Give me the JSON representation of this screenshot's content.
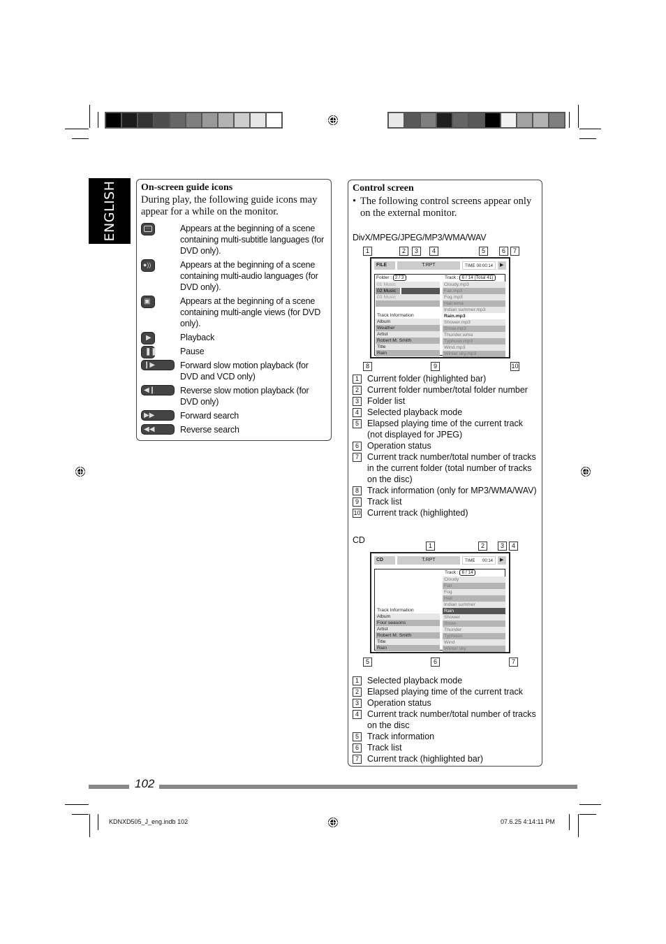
{
  "language_tab": "ENGLISH",
  "guide_icons": {
    "title": "On-screen guide icons",
    "intro": "During play, the following guide icons may appear for a while on the monitor.",
    "items": [
      {
        "icon": "subtitle-icon",
        "text": "Appears at the beginning of a scene containing multi-subtitle languages (for DVD only)."
      },
      {
        "icon": "audio-icon",
        "text": "Appears at the beginning of a scene containing multi-audio languages (for DVD only)."
      },
      {
        "icon": "angle-icon",
        "text": "Appears at the beginning of a scene containing multi-angle views (for DVD only)."
      },
      {
        "icon": "play-icon",
        "text": "Playback"
      },
      {
        "icon": "pause-icon",
        "text": "Pause"
      },
      {
        "icon": "forward-slow-icon",
        "text": "Forward slow motion playback (for DVD and VCD only)"
      },
      {
        "icon": "reverse-slow-icon",
        "text": "Reverse slow motion playback (for DVD only)"
      },
      {
        "icon": "forward-search-icon",
        "text": "Forward search"
      },
      {
        "icon": "reverse-search-icon",
        "text": "Reverse search"
      }
    ]
  },
  "control_screen": {
    "title": "Control screen",
    "bullet": "The following control screens appear only on the external monitor.",
    "divx": {
      "heading": "DivX/MPEG/JPEG/MP3/WMA/WAV",
      "screen": {
        "mode_label": "FILE",
        "repeat": "T.RPT",
        "time_label": "TIME",
        "time_value": "00:00:14",
        "status_glyph": "▶",
        "folder_label": "Folder :",
        "folder_value": "2 / 3",
        "track_label": "Track :",
        "track_value": "6 / 14 (Total 41)",
        "folders": [
          "01 Music",
          "02 Music",
          "03 Music",
          ""
        ],
        "current_folder_index": 1,
        "info_heading": "Track Information",
        "info_rows": [
          "Album",
          "Weather",
          "Artist",
          "Robert M. Smith",
          "Title",
          "Rain"
        ],
        "tracks": [
          "Cloudy.mp3",
          "Fair.mp3",
          "Fog.mp3",
          "Hail.wma",
          "Indian summer.mp3",
          "Rain.mp3",
          "Shower.mp3",
          "Snow.mp3",
          "Thunder.wma",
          "Typhoon.mp3",
          "Wind.mp3",
          "Winter sky.mp3"
        ],
        "current_track_index": 5
      },
      "callout_numbers": [
        "1",
        "2",
        "3",
        "4",
        "5",
        "6",
        "7",
        "8",
        "9",
        "10"
      ],
      "legend": [
        {
          "n": "1",
          "text": "Current folder (highlighted bar)"
        },
        {
          "n": "2",
          "text": "Current folder number/total folder number"
        },
        {
          "n": "3",
          "text": "Folder list"
        },
        {
          "n": "4",
          "text": "Selected playback mode"
        },
        {
          "n": "5",
          "text": "Elapsed playing time of the current track (not displayed for JPEG)"
        },
        {
          "n": "6",
          "text": "Operation status"
        },
        {
          "n": "7",
          "text": "Current track number/total number of tracks in the current folder (total number of tracks on the disc)"
        },
        {
          "n": "8",
          "text": "Track information (only for MP3/WMA/WAV)"
        },
        {
          "n": "9",
          "text": "Track list"
        },
        {
          "n": "10",
          "text": "Current track (highlighted)"
        }
      ]
    },
    "cd": {
      "heading": "CD",
      "screen": {
        "mode_label": "CD",
        "repeat": "T.RPT",
        "time_label": "TIME",
        "time_value": "00:14",
        "status_glyph": "▶",
        "track_label": "Track :",
        "track_value": "6 / 14",
        "info_heading": "Track Information",
        "info_rows": [
          "Album",
          "Four seasons",
          "Artist",
          "Robert M. Smith",
          "Title",
          "Rain"
        ],
        "tracks": [
          "Cloudy",
          "Fair",
          "Fog",
          "Hail",
          "Indian summer",
          "Rain",
          "Shower",
          "Snow",
          "Thunder",
          "Typhoon",
          "Wind",
          "Winter sky"
        ],
        "current_track_index": 5
      },
      "callout_numbers": [
        "1",
        "2",
        "3",
        "4",
        "5",
        "6",
        "7"
      ],
      "legend": [
        {
          "n": "1",
          "text": "Selected playback mode"
        },
        {
          "n": "2",
          "text": "Elapsed playing time of the current track"
        },
        {
          "n": "3",
          "text": "Operation status"
        },
        {
          "n": "4",
          "text": "Current track number/total number of tracks on the disc"
        },
        {
          "n": "5",
          "text": "Track information"
        },
        {
          "n": "6",
          "text": "Track list"
        },
        {
          "n": "7",
          "text": "Current track (highlighted bar)"
        }
      ]
    }
  },
  "page_number": "102",
  "footer": {
    "file": "KDNXD505_J_eng.indb   102",
    "timestamp": "07.6.25   4:14:11 PM"
  },
  "colorbars": {
    "left": [
      "#000000",
      "#1c1c1c",
      "#333333",
      "#4d4d4d",
      "#666666",
      "#7f7f7f",
      "#999999",
      "#b3b3b3",
      "#cccccc",
      "#e6e6e6",
      "#ffffff"
    ],
    "right": [
      "#e8e8e8",
      "#585858",
      "#7f7f7f",
      "#1e1e1e",
      "#656565",
      "#585858",
      "#000000",
      "#f2f2f2",
      "#a2a2a2",
      "#b3b3b3",
      "#7f7f7f"
    ]
  }
}
